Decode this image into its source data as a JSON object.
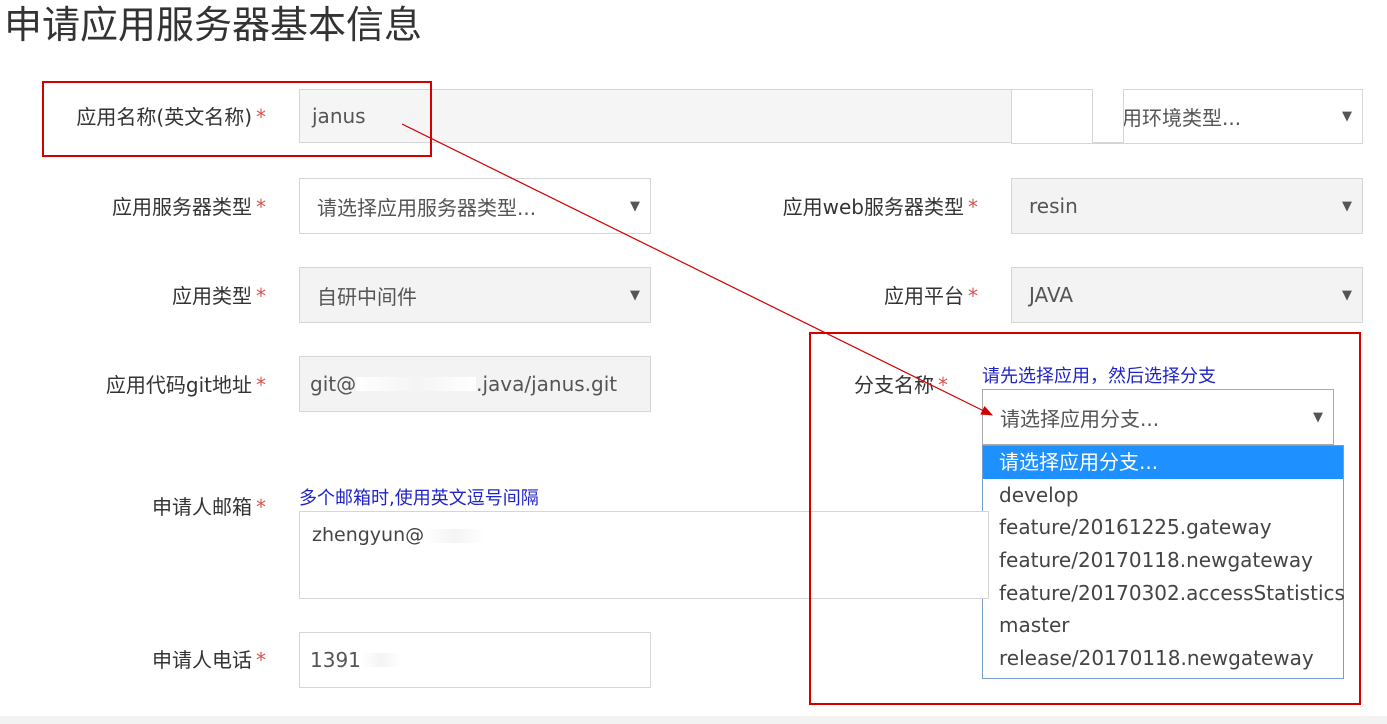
{
  "page": {
    "title": "申请应用服务器基本信息"
  },
  "required_mark": "*",
  "fields": {
    "app_name": {
      "label": "应用名称(英文名称)",
      "value": "janus"
    },
    "env_type": {
      "value": "用环境类型..."
    },
    "server_type": {
      "label": "应用服务器类型",
      "value": "请选择应用服务器类型..."
    },
    "web_server_type": {
      "label": "应用web服务器类型",
      "value": "resin"
    },
    "app_type": {
      "label": "应用类型",
      "value": "自研中间件"
    },
    "platform": {
      "label": "应用平台",
      "value": "JAVA"
    },
    "git_addr": {
      "label": "应用代码git地址",
      "value_prefix": "git@",
      "value_suffix": ".java/janus.git"
    },
    "branch": {
      "label": "分支名称",
      "hint": "请先选择应用，然后选择分支",
      "value": "请选择应用分支...",
      "options": [
        "请选择应用分支...",
        "develop",
        "feature/20161225.gateway",
        "feature/20170118.newgateway",
        "feature/20170302.accessStatistics",
        "master",
        "release/20170118.newgateway"
      ]
    },
    "email": {
      "label": "申请人邮箱",
      "hint": "多个邮箱时,使用英文逗号间隔",
      "value": "zhengyun@"
    },
    "phone": {
      "label": "申请人电话",
      "value": "1391"
    }
  },
  "icons": {
    "caret": "▼"
  },
  "colors": {
    "annotation_red": "#d40000",
    "hint_blue": "#1f23c9",
    "required_red": "#d9534f",
    "selected_option": "#1e90ff"
  }
}
